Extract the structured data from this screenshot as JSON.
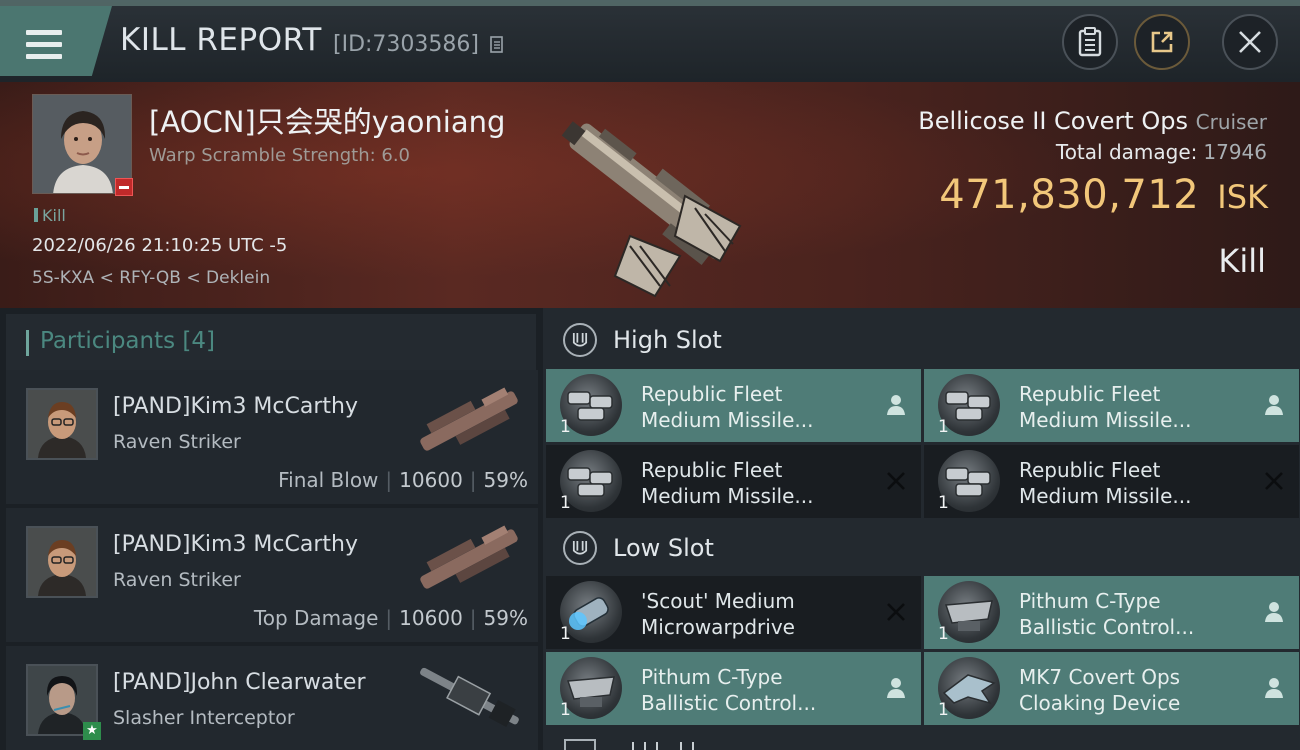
{
  "header": {
    "title": "KILL REPORT",
    "id_label": "[ID:7303586]",
    "icons": [
      "menu-icon",
      "copy-icon",
      "clipboard-icon",
      "share-icon",
      "close-icon"
    ]
  },
  "victim": {
    "name": "[AOCN]只会哭的yaoniang",
    "warp_scramble": "Warp Scramble Strength: 6.0",
    "kill_tag": "Kill",
    "datetime": "2022/06/26 21:10:25 UTC -5",
    "location": "5S-KXA < RFY-QB < Deklein",
    "ship_name": "Bellicose II Covert Ops",
    "ship_class": "Cruiser",
    "total_damage_label": "Total damage:",
    "total_damage": "17946",
    "isk_value": "471,830,712",
    "isk_unit": "ISK",
    "result": "Kill"
  },
  "participants": {
    "title": "Participants",
    "count": "[4]",
    "rows": [
      {
        "name": "[PAND]Kim3 McCarthy",
        "ship": "Raven Striker",
        "label": "Final Blow",
        "damage": "10600",
        "percent": "59%"
      },
      {
        "name": "[PAND]Kim3 McCarthy",
        "ship": "Raven Striker",
        "label": "Top Damage",
        "damage": "10600",
        "percent": "59%"
      },
      {
        "name": "[PAND]John Clearwater",
        "ship": "Slasher Interceptor",
        "label": "",
        "damage": "",
        "percent": ""
      }
    ]
  },
  "fittings": {
    "high_slot": {
      "title": "High Slot",
      "modules": [
        {
          "line1": "Republic Fleet",
          "line2": "Medium Missile...",
          "qty": "1",
          "status": "fitted"
        },
        {
          "line1": "Republic Fleet",
          "line2": "Medium Missile...",
          "qty": "1",
          "status": "fitted"
        },
        {
          "line1": "Republic Fleet",
          "line2": "Medium Missile...",
          "qty": "1",
          "status": "destroyed"
        },
        {
          "line1": "Republic Fleet",
          "line2": "Medium Missile...",
          "qty": "1",
          "status": "destroyed"
        }
      ]
    },
    "low_slot": {
      "title": "Low Slot",
      "modules": [
        {
          "line1": "'Scout' Medium",
          "line2": "Microwarpdrive",
          "qty": "1",
          "status": "destroyed"
        },
        {
          "line1": "Pithum C-Type",
          "line2": "Ballistic Control...",
          "qty": "1",
          "status": "fitted"
        },
        {
          "line1": "Pithum C-Type",
          "line2": "Ballistic Control...",
          "qty": "1",
          "status": "fitted"
        },
        {
          "line1": "MK7 Covert Ops",
          "line2": "Cloaking Device",
          "qty": "1",
          "status": "fitted"
        }
      ]
    }
  },
  "colors": {
    "accent_teal": "#4f7c77",
    "isk_gold": "#f2c77a",
    "banner_red": "#5a2922",
    "destroyed_dark": "#191d21"
  }
}
